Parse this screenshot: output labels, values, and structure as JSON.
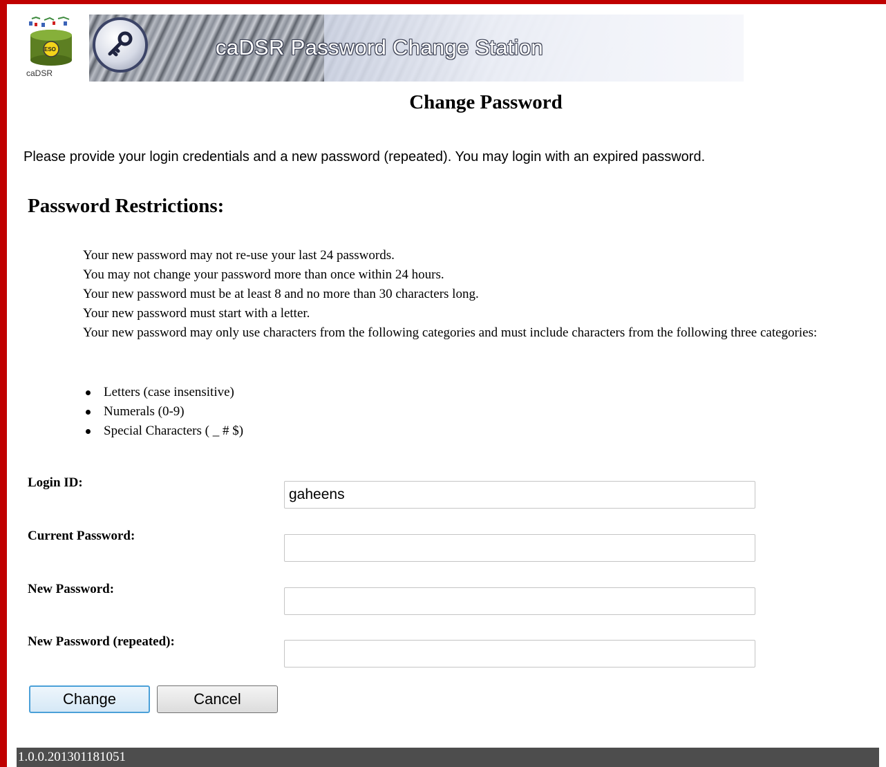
{
  "banner": {
    "title": "caDSR Password Change Station",
    "logo_text": "caDSR",
    "logo_badge": "ESO"
  },
  "page_title": "Change Password",
  "intro": "Please provide your login credentials and a new password (repeated). You may login with an expired password.",
  "restrictions": {
    "heading": "Password Restrictions:",
    "rules": [
      "Your new password may not re-use your last 24 passwords.",
      "You may not change your password more than once within 24 hours.",
      "Your new password must be at least 8 and no more than 30 characters long.",
      "Your new password must start with a letter.",
      "Your new password may only use characters from the following categories and must include characters from the following three categories:"
    ],
    "categories": [
      "Letters (case insensitive)",
      "Numerals (0-9)",
      "Special Characters ( _ # $)"
    ]
  },
  "form": {
    "login_id": {
      "label": "Login ID:",
      "value": "gaheens"
    },
    "current_password": {
      "label": "Current Password:",
      "value": ""
    },
    "new_password": {
      "label": "New Password:",
      "value": ""
    },
    "new_password_repeated": {
      "label": "New Password (repeated):",
      "value": ""
    }
  },
  "buttons": {
    "change": "Change",
    "cancel": "Cancel"
  },
  "footer": {
    "version": "1.0.0.201301181051"
  },
  "colors": {
    "frame": "#c00000",
    "footer_bg": "#4d4d4d",
    "default_button_border": "#4aa0d8"
  }
}
